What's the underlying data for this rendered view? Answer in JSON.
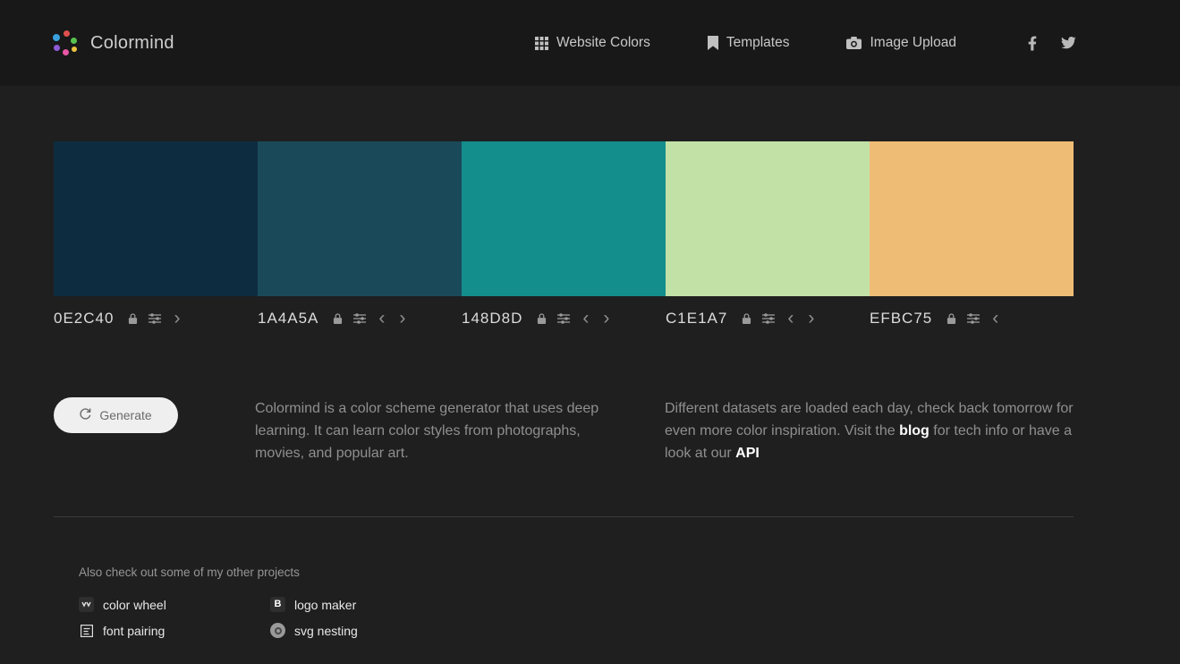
{
  "header": {
    "brand": "Colormind",
    "nav": [
      {
        "label": "Website Colors"
      },
      {
        "label": "Templates"
      },
      {
        "label": "Image Upload"
      }
    ]
  },
  "palette": {
    "swatches": [
      {
        "hex": "0E2C40",
        "color": "#0E2C40"
      },
      {
        "hex": "1A4A5A",
        "color": "#1A4A5A"
      },
      {
        "hex": "148D8D",
        "color": "#148D8D"
      },
      {
        "hex": "C1E1A7",
        "color": "#C1E1A7"
      },
      {
        "hex": "EFBC75",
        "color": "#EFBC75"
      }
    ]
  },
  "actions": {
    "generate_label": "Generate"
  },
  "about": {
    "col1": "Colormind is a color scheme generator that uses deep learning. It can learn color styles from photographs, movies, and popular art.",
    "col2_part1": "Different datasets are loaded each day, check back tomorrow for even more color inspiration. Visit the ",
    "col2_link_blog": "blog",
    "col2_part2": " for tech info or have a look at our ",
    "col2_link_api": "API"
  },
  "footer": {
    "heading": "Also check out some of my other projects",
    "projects": [
      {
        "label": "color wheel"
      },
      {
        "label": "logo maker"
      },
      {
        "label": "font pairing"
      },
      {
        "label": "svg nesting"
      }
    ],
    "logo_maker_glyph": "B"
  },
  "icons": {
    "chevron_left": "‹",
    "chevron_right": "›"
  }
}
